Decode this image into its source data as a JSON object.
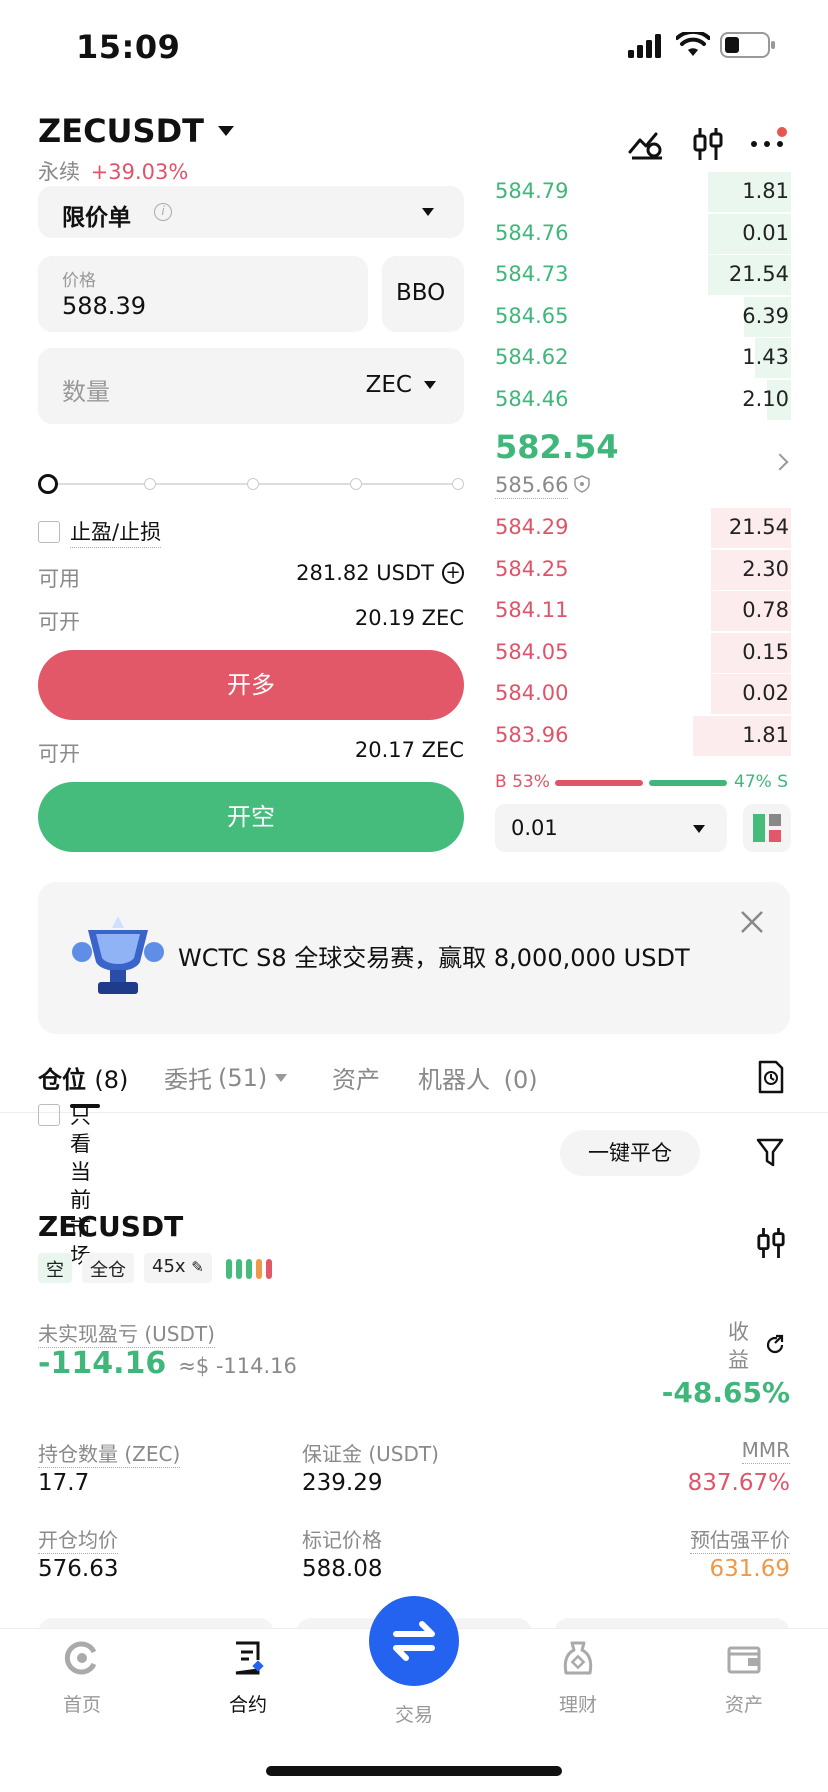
{
  "status_bar": {
    "time": "15:09"
  },
  "header": {
    "symbol": "ZECUSDT",
    "type_label": "永续",
    "change": "+39.03%"
  },
  "order_form": {
    "order_type": "限价单",
    "price_label": "价格",
    "price_value": "588.39",
    "bbo_label": "BBO",
    "qty_placeholder": "数量",
    "qty_unit": "ZEC",
    "tp_sl_label": "止盈/止损",
    "available_label": "可用",
    "available_value": "281.82 USDT",
    "can_open_label_1": "可开",
    "can_open_value_1": "20.19 ZEC",
    "long_button": "开多",
    "can_open_label_2": "可开",
    "can_open_value_2": "20.17 ZEC",
    "short_button": "开空"
  },
  "order_book": {
    "asks": [
      {
        "price": "584.79",
        "qty": "1.81",
        "depth": 0.28
      },
      {
        "price": "584.76",
        "qty": "0.01",
        "depth": 0.28
      },
      {
        "price": "584.73",
        "qty": "21.54",
        "depth": 0.28
      },
      {
        "price": "584.65",
        "qty": "6.39",
        "depth": 0.16
      },
      {
        "price": "584.62",
        "qty": "1.43",
        "depth": 0.12
      },
      {
        "price": "584.46",
        "qty": "2.10",
        "depth": 0.08
      }
    ],
    "last_price": "582.54",
    "mark_price": "585.66",
    "bids": [
      {
        "price": "584.29",
        "qty": "21.54",
        "depth": 0.27
      },
      {
        "price": "584.25",
        "qty": "2.30",
        "depth": 0.27
      },
      {
        "price": "584.11",
        "qty": "0.78",
        "depth": 0.27
      },
      {
        "price": "584.05",
        "qty": "0.15",
        "depth": 0.27
      },
      {
        "price": "584.00",
        "qty": "0.02",
        "depth": 0.27
      },
      {
        "price": "583.96",
        "qty": "1.81",
        "depth": 0.33
      }
    ],
    "buy_ratio_label": "B 53%",
    "sell_ratio_label": "47% S",
    "buy_ratio": 0.53,
    "precision": "0.01"
  },
  "banner": {
    "text": "WCTC S8 全球交易赛，赢取 8,000,000 USDT"
  },
  "tabs": [
    {
      "label": "仓位",
      "count": "(8)"
    },
    {
      "label": "委托",
      "count": "(51)"
    },
    {
      "label": "资产",
      "count": ""
    },
    {
      "label": "机器人",
      "count": "(0)"
    }
  ],
  "positions": {
    "filter_label": "只看当前市场",
    "close_all_button": "一键平仓",
    "symbol": "ZECUSDT",
    "side_tag": "空",
    "margin_tag": "全仓",
    "leverage_tag": "45x",
    "unrealized_label": "未实现盈亏 (USDT)",
    "unrealized_value": "-114.16",
    "unrealized_usd": "≈$ -114.16",
    "roe_label": "收益",
    "roe_value": "-48.65%",
    "size_label": "持仓数量 (ZEC)",
    "size_value": "17.7",
    "margin_label": "保证金 (USDT)",
    "margin_value": "239.29",
    "mmr_label": "MMR",
    "mmr_value": "837.67%",
    "entry_label": "开仓均价",
    "entry_value": "576.63",
    "mark_label": "标记价格",
    "mark_value": "588.08",
    "liq_label": "预估强平价",
    "liq_value": "631.69"
  },
  "bottom_nav": [
    {
      "label": "首页",
      "icon": "home-icon"
    },
    {
      "label": "合约",
      "icon": "contract-icon"
    },
    {
      "label": "交易",
      "icon": "swap-icon"
    },
    {
      "label": "理财",
      "icon": "earn-icon"
    },
    {
      "label": "资产",
      "icon": "wallet-icon"
    }
  ],
  "colors": {
    "green": "#3fb77a",
    "red": "#e0546a",
    "orange": "#ec9a4a",
    "blue": "#2463f0"
  }
}
